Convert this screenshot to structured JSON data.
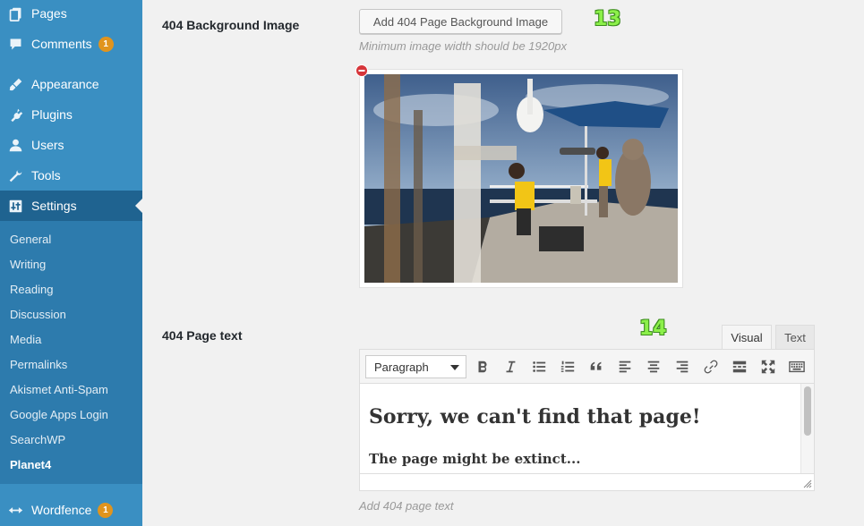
{
  "sidebar": {
    "menu": [
      {
        "label": "Pages",
        "icon": "pages-icon"
      },
      {
        "label": "Comments",
        "icon": "comments-icon",
        "badge": "1"
      },
      {
        "label": "Appearance",
        "icon": "appearance-icon"
      },
      {
        "label": "Plugins",
        "icon": "plugins-icon"
      },
      {
        "label": "Users",
        "icon": "users-icon"
      },
      {
        "label": "Tools",
        "icon": "tools-icon"
      },
      {
        "label": "Settings",
        "icon": "settings-icon",
        "active": true
      }
    ],
    "submenu": [
      "General",
      "Writing",
      "Reading",
      "Discussion",
      "Media",
      "Permalinks",
      "Akismet Anti-Spam",
      "Google Apps Login",
      "SearchWP",
      "Planet4"
    ],
    "submenu_current": "Planet4",
    "wordfence": {
      "label": "Wordfence",
      "badge": "1"
    }
  },
  "background_image": {
    "label": "404 Background Image",
    "button_label": "Add 404 Page Background Image",
    "hint": "Minimum image width should be 1920px",
    "step": "13"
  },
  "page_text": {
    "label": "404 Page text",
    "step": "14",
    "tabs": [
      "Visual",
      "Text"
    ],
    "active_tab": "Visual",
    "format_value": "Paragraph",
    "heading": "Sorry, we can't find that page!",
    "subheading": "The page might be extinct...",
    "hint": "Add 404 page text"
  },
  "colors": {
    "sidebar": "#3a8fc2",
    "sidebar_active": "#1f6390",
    "badge": "#e0941e",
    "step_number": "#8cf04a"
  }
}
